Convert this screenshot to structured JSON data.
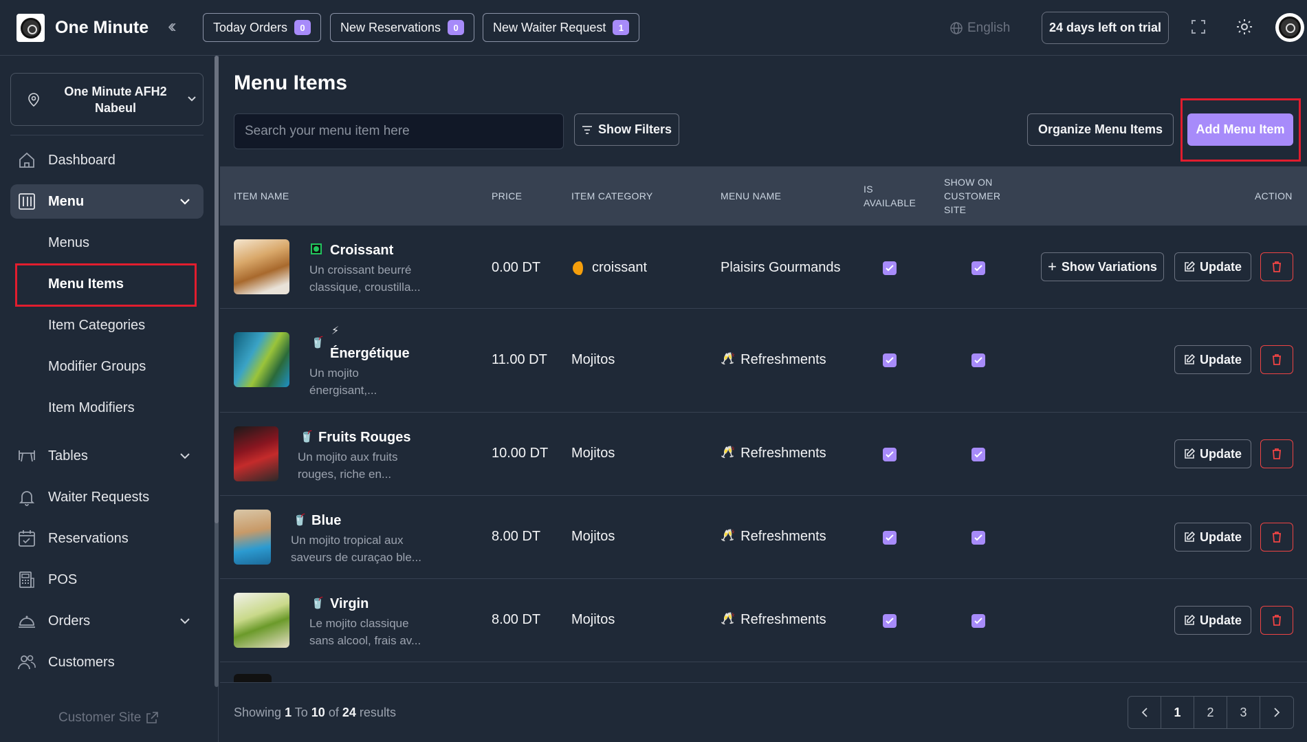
{
  "app": {
    "title": "One Minute"
  },
  "topbar": {
    "today_orders": {
      "label": "Today Orders",
      "count": "0"
    },
    "new_reservations": {
      "label": "New Reservations",
      "count": "0"
    },
    "new_waiter_request": {
      "label": "New Waiter Request",
      "count": "1"
    },
    "language": "English",
    "trial": "24 days left on trial"
  },
  "sidebar": {
    "branch": "One Minute AFH2 Nabeul",
    "items": [
      {
        "label": "Dashboard",
        "icon": "home-icon"
      },
      {
        "label": "Menu",
        "icon": "menu-book-icon"
      },
      {
        "label": "Tables",
        "icon": "table-icon"
      },
      {
        "label": "Waiter Requests",
        "icon": "bell-icon"
      },
      {
        "label": "Reservations",
        "icon": "calendar-icon"
      },
      {
        "label": "POS",
        "icon": "pos-icon"
      },
      {
        "label": "Orders",
        "icon": "cloche-icon"
      },
      {
        "label": "Customers",
        "icon": "users-icon"
      }
    ],
    "menu_sub": [
      "Menus",
      "Menu Items",
      "Item Categories",
      "Modifier Groups",
      "Item Modifiers"
    ],
    "customer_site": "Customer Site"
  },
  "main": {
    "title": "Menu Items",
    "search_placeholder": "Search your menu item here",
    "show_filters": "Show Filters",
    "organize": "Organize Menu Items",
    "add": "Add Menu Item",
    "columns": [
      "ITEM NAME",
      "PRICE",
      "ITEM CATEGORY",
      "MENU NAME",
      "IS AVAILABLE",
      "SHOW ON CUSTOMER SITE",
      "ACTION"
    ],
    "rows": [
      {
        "name": "Croissant",
        "desc1": "Un croissant beurré",
        "desc2": "classique, croustilla...",
        "price": "0.00 DT",
        "category": "croissant",
        "menu": "Plaisirs Gourmands",
        "available": true,
        "show_site": true,
        "variations": "Show Variations"
      },
      {
        "name": "Énergétique",
        "desc1": "Un mojito",
        "desc2": "énergisant,...",
        "price": "11.00 DT",
        "category": "Mojitos",
        "menu": "Refreshments",
        "available": true,
        "show_site": true
      },
      {
        "name": "Fruits Rouges",
        "desc1": "Un mojito aux fruits",
        "desc2": "rouges, riche en...",
        "price": "10.00 DT",
        "category": "Mojitos",
        "menu": "Refreshments",
        "available": true,
        "show_site": true
      },
      {
        "name": "Blue",
        "desc1": "Un mojito tropical aux",
        "desc2": "saveurs de curaçao ble...",
        "price": "8.00 DT",
        "category": "Mojitos",
        "menu": "Refreshments",
        "available": true,
        "show_site": true
      },
      {
        "name": "Virgin",
        "desc1": "Le mojito classique",
        "desc2": "sans alcool, frais av...",
        "price": "8.00 DT",
        "category": "Mojitos",
        "menu": "Refreshments",
        "available": true,
        "show_site": true
      }
    ],
    "update_label": "Update"
  },
  "footer": {
    "showing": "Showing",
    "from": "1",
    "to_label": "To",
    "to": "10",
    "of_label": "of",
    "total": "24",
    "results_label": "results",
    "pages": [
      "1",
      "2",
      "3"
    ]
  },
  "colors": {
    "accent": "#a78bfa",
    "background": "#1f2937",
    "highlight": "#e11d2e",
    "danger": "#ef4444"
  }
}
